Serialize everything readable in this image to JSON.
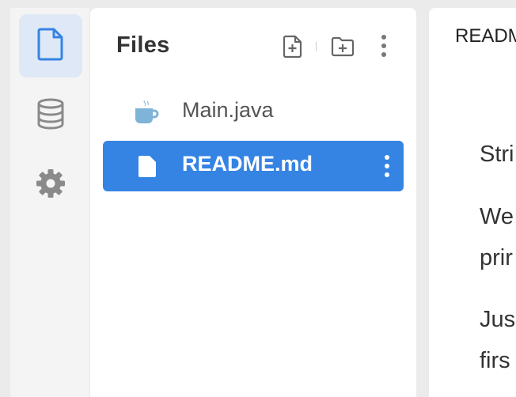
{
  "rail": {
    "items": [
      {
        "icon": "file-icon",
        "active": true
      },
      {
        "icon": "database-icon",
        "active": false
      },
      {
        "icon": "gear-icon",
        "active": false
      }
    ]
  },
  "files": {
    "title": "Files",
    "header_icons": [
      "new-file-icon",
      "new-folder-icon",
      "more-vertical-icon"
    ],
    "items": [
      {
        "name": "Main.java",
        "icon": "java-cup-icon",
        "selected": false
      },
      {
        "name": "README.md",
        "icon": "document-icon",
        "selected": true
      }
    ]
  },
  "editor": {
    "tab_title": "READM",
    "lines": [
      "Stri",
      "We",
      "prir",
      "Jus",
      "firs"
    ]
  },
  "colors": {
    "accent": "#3584e4",
    "active_rail_bg": "#dfe8f6",
    "icon_gray": "#8a8a8a",
    "java_blue": "#7fb3d8"
  }
}
